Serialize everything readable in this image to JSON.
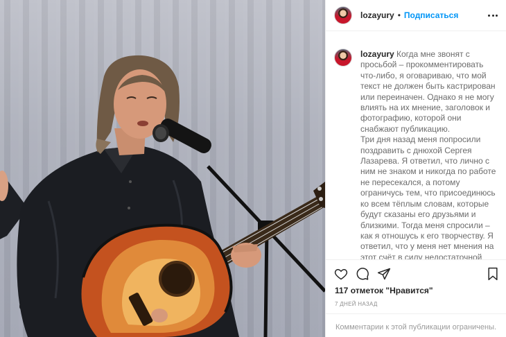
{
  "post": {
    "username": "lozayury",
    "dot": "•",
    "follow_label": "Подписаться",
    "caption_user": "lozayury",
    "caption_text": " Когда мне звонят с просьбой – прокомментировать что-либо, я оговариваю, что мой текст не должен быть кастрирован или переиначен. Однако я не могу влиять на их мнение, заголовок и фотографию, которой они снабжают публикацию.\nТри дня назад меня попросили поздравить с днюхой Сергея Лазарева. Я ответил, что лично с ним не знаком и никогда по работе не пересекался, а потому ограничусь тем, что присоединюсь ко всем тёплым словам, которые будут сказаны его друзьями и близкими. Тогда меня спросили – как я отношусь к его творчеству. Я ответил, что у меня нет мнения на этот счёт в силу недостаточной",
    "likes": "117 отметок \"Нравится\"",
    "time_ago": "7 ДНЕЙ НАЗАД",
    "comments_limited": "Комментарии к этой публикации ограничены."
  },
  "icons": {
    "more": "more-options-icon",
    "like": "heart-icon",
    "comment": "comment-icon",
    "share": "share-icon",
    "save": "bookmark-icon"
  },
  "colors": {
    "follow_blue": "#0095f6",
    "text": "#262626",
    "muted": "#8e8e8e",
    "guitar_sunburst": "#c4521f"
  }
}
